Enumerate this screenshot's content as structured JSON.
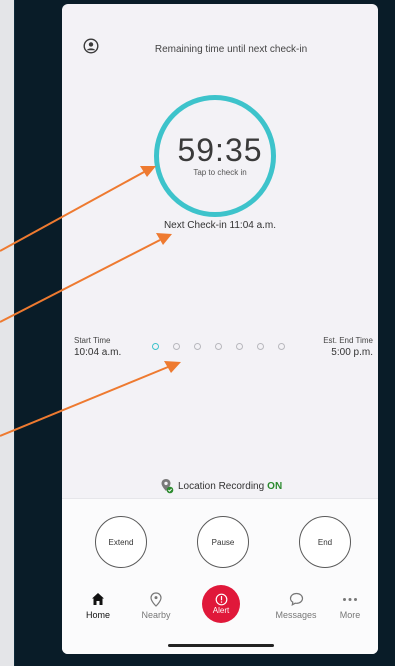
{
  "header": {
    "remaining_label": "Remaining time until next check-in"
  },
  "timer": {
    "value": "59:35",
    "tap_label": "Tap to check in"
  },
  "next_checkin": "Next Check-in 11:04 a.m.",
  "schedule": {
    "start_label": "Start Time",
    "start_value": "10:04 a.m.",
    "end_label": "Est. End Time",
    "end_value": "5:00 p.m.",
    "progress": {
      "completed": 1,
      "total": 7
    }
  },
  "location": {
    "label": "Location Recording",
    "status": "ON"
  },
  "actions": {
    "extend": "Extend",
    "pause": "Pause",
    "end": "End"
  },
  "nav": {
    "home": "Home",
    "nearby": "Nearby",
    "alert": "Alert",
    "messages": "Messages",
    "more": "More"
  },
  "colors": {
    "accent": "#3dc3cb",
    "alert": "#e0183a",
    "arrow": "#ee7a30",
    "status_on": "#2b8a2e"
  },
  "icons": [
    "profile-icon",
    "location-pin-icon",
    "home-icon",
    "nearby-icon",
    "alert-icon",
    "messages-icon",
    "more-icon"
  ]
}
